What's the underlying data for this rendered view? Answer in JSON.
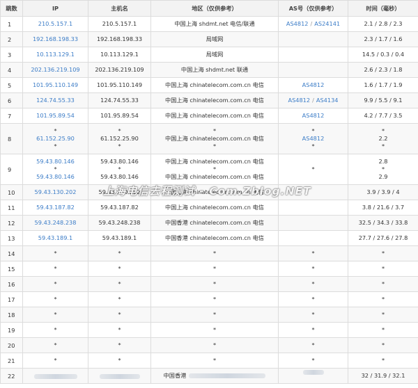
{
  "headers": {
    "hop": "跳数",
    "ip": "IP",
    "host": "主机名",
    "region": "地区（仅供参考）",
    "as": "AS号（仅供参考）",
    "time": "时间（毫秒）"
  },
  "rows": [
    {
      "hop": "1",
      "ip": [
        "210.5.157.1"
      ],
      "host": [
        "210.5.157.1"
      ],
      "region": [
        "中国上海 shdmt.net 电信/联通"
      ],
      "as": [
        [
          "AS4812",
          "AS24141"
        ]
      ],
      "time": [
        "2.1 / 2.8 / 2.3"
      ]
    },
    {
      "hop": "2",
      "ip": [
        "192.168.198.33"
      ],
      "host": [
        "192.168.198.33"
      ],
      "region": [
        "局域网"
      ],
      "as": [
        []
      ],
      "time": [
        "2.3 / 1.7 / 1.6"
      ]
    },
    {
      "hop": "3",
      "ip": [
        "10.113.129.1"
      ],
      "host": [
        "10.113.129.1"
      ],
      "region": [
        "局域网"
      ],
      "as": [
        []
      ],
      "time": [
        "14.5 / 0.3 / 0.4"
      ]
    },
    {
      "hop": "4",
      "ip": [
        "202.136.219.109"
      ],
      "host": [
        "202.136.219.109"
      ],
      "region": [
        "中国上海 shdmt.net 联通"
      ],
      "as": [
        []
      ],
      "time": [
        "2.6 / 2.3 / 1.8"
      ]
    },
    {
      "hop": "5",
      "ip": [
        "101.95.110.149"
      ],
      "host": [
        "101.95.110.149"
      ],
      "region": [
        "中国上海 chinatelecom.com.cn 电信"
      ],
      "as": [
        [
          "AS4812"
        ]
      ],
      "time": [
        "1.6 / 1.7 / 1.9"
      ]
    },
    {
      "hop": "6",
      "ip": [
        "124.74.55.33"
      ],
      "host": [
        "124.74.55.33"
      ],
      "region": [
        "中国上海 chinatelecom.com.cn 电信"
      ],
      "as": [
        [
          "AS4812",
          "AS4134"
        ]
      ],
      "time": [
        "9.9 / 5.5 / 9.1"
      ]
    },
    {
      "hop": "7",
      "ip": [
        "101.95.89.54"
      ],
      "host": [
        "101.95.89.54"
      ],
      "region": [
        "中国上海 chinatelecom.com.cn 电信"
      ],
      "as": [
        [
          "AS4812"
        ]
      ],
      "time": [
        "4.2 / 7.7 / 3.5"
      ]
    },
    {
      "hop": "8",
      "ip": [
        "*",
        "61.152.25.90",
        "*"
      ],
      "host": [
        "*",
        "61.152.25.90",
        "*"
      ],
      "region": [
        "*",
        "中国上海 chinatelecom.com.cn 电信",
        "*"
      ],
      "as": [
        [
          "*"
        ],
        [
          "AS4812"
        ],
        [
          "*"
        ]
      ],
      "time": [
        "*",
        "2.2",
        "*"
      ]
    },
    {
      "hop": "9",
      "ip": [
        "59.43.80.146",
        "*",
        "59.43.80.146"
      ],
      "host": [
        "59.43.80.146",
        "*",
        "59.43.80.146"
      ],
      "region": [
        "中国上海 chinatelecom.com.cn 电信",
        "*",
        "中国上海 chinatelecom.com.cn 电信"
      ],
      "as": [
        [],
        [
          "*"
        ],
        []
      ],
      "time": [
        "2.8",
        "*",
        "2.9"
      ]
    },
    {
      "hop": "10",
      "ip": [
        "59.43.130.202"
      ],
      "host": [
        "59.43.130.202"
      ],
      "region": [
        "中国上海 chinatelecom.com.cn 电信"
      ],
      "as": [
        []
      ],
      "time": [
        "3.9 / 3.9 / 4"
      ]
    },
    {
      "hop": "11",
      "ip": [
        "59.43.187.82"
      ],
      "host": [
        "59.43.187.82"
      ],
      "region": [
        "中国上海 chinatelecom.com.cn 电信"
      ],
      "as": [
        []
      ],
      "time": [
        "3.8 / 21.6 / 3.7"
      ]
    },
    {
      "hop": "12",
      "ip": [
        "59.43.248.238"
      ],
      "host": [
        "59.43.248.238"
      ],
      "region": [
        "中国香港 chinatelecom.com.cn 电信"
      ],
      "as": [
        []
      ],
      "time": [
        "32.5 / 34.3 / 33.8"
      ]
    },
    {
      "hop": "13",
      "ip": [
        "59.43.189.1"
      ],
      "host": [
        "59.43.189.1"
      ],
      "region": [
        "中国香港 chinatelecom.com.cn 电信"
      ],
      "as": [
        []
      ],
      "time": [
        "27.7 / 27.6 / 27.8"
      ]
    },
    {
      "hop": "14",
      "ip": [
        "*"
      ],
      "host": [
        "*"
      ],
      "region": [
        "*"
      ],
      "as": [
        [
          "*"
        ]
      ],
      "time": [
        "*"
      ]
    },
    {
      "hop": "15",
      "ip": [
        "*"
      ],
      "host": [
        "*"
      ],
      "region": [
        "*"
      ],
      "as": [
        [
          "*"
        ]
      ],
      "time": [
        "*"
      ]
    },
    {
      "hop": "16",
      "ip": [
        "*"
      ],
      "host": [
        "*"
      ],
      "region": [
        "*"
      ],
      "as": [
        [
          "*"
        ]
      ],
      "time": [
        "*"
      ]
    },
    {
      "hop": "17",
      "ip": [
        "*"
      ],
      "host": [
        "*"
      ],
      "region": [
        "*"
      ],
      "as": [
        [
          "*"
        ]
      ],
      "time": [
        "*"
      ]
    },
    {
      "hop": "18",
      "ip": [
        "*"
      ],
      "host": [
        "*"
      ],
      "region": [
        "*"
      ],
      "as": [
        [
          "*"
        ]
      ],
      "time": [
        "*"
      ]
    },
    {
      "hop": "19",
      "ip": [
        "*"
      ],
      "host": [
        "*"
      ],
      "region": [
        "*"
      ],
      "as": [
        [
          "*"
        ]
      ],
      "time": [
        "*"
      ]
    },
    {
      "hop": "20",
      "ip": [
        "*"
      ],
      "host": [
        "*"
      ],
      "region": [
        "*"
      ],
      "as": [
        [
          "*"
        ]
      ],
      "time": [
        "*"
      ]
    },
    {
      "hop": "21",
      "ip": [
        "*"
      ],
      "host": [
        "*"
      ],
      "region": [
        "*"
      ],
      "as": [
        [
          "*"
        ]
      ],
      "time": [
        "*"
      ]
    },
    {
      "hop": "22",
      "ip": [],
      "host": [],
      "region": [
        "中国香港"
      ],
      "as": [
        []
      ],
      "time": [
        "32 / 31.9 / 32.1"
      ],
      "redacted": true
    }
  ],
  "watermark": "上海电信去程测试 - Com.Zblog.NET",
  "colors": {
    "link": "#3b7cc7",
    "header_bg": "#f3f3f3",
    "border": "#dcdcdc",
    "zebra": "#f8f8f8"
  }
}
